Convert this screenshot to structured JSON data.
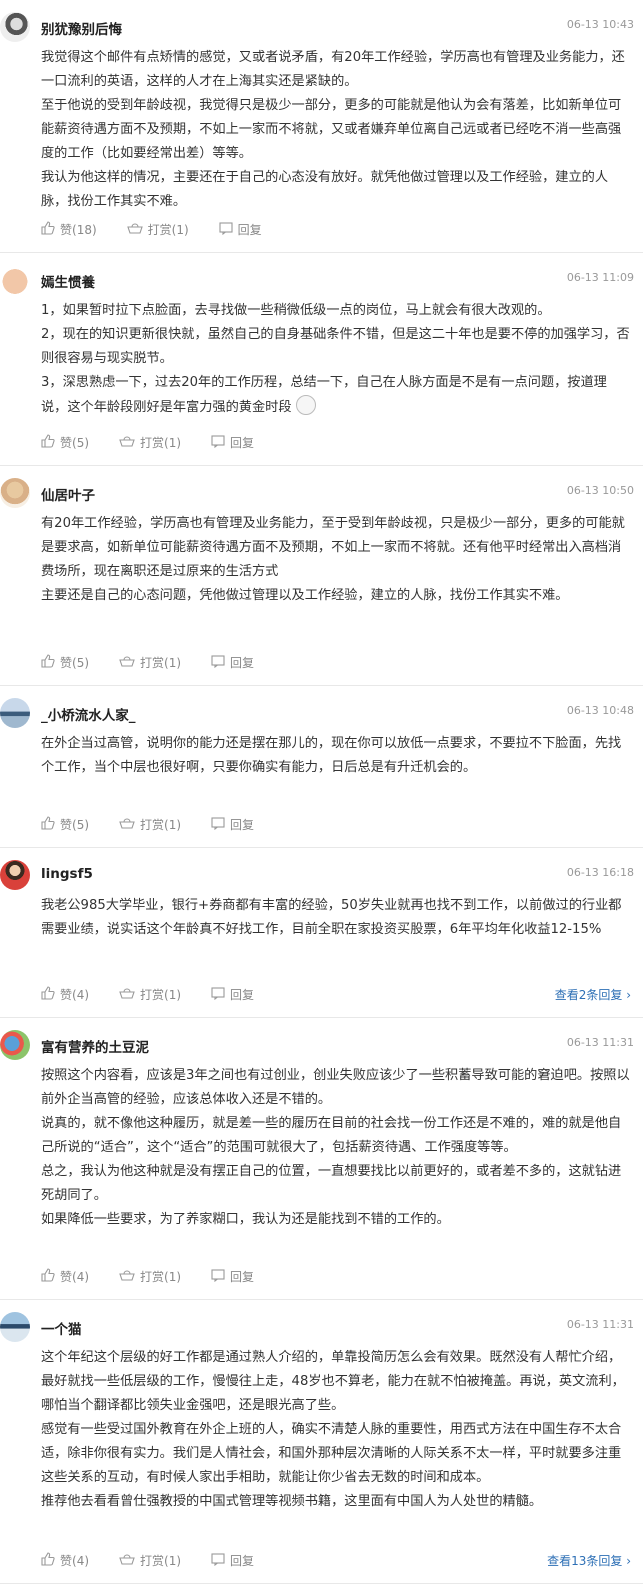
{
  "labels": {
    "like": "赞",
    "reward": "打赏",
    "reply": "回复"
  },
  "comments": [
    {
      "user": "别犹豫别后悔",
      "time": "06-13 10:43",
      "paragraphs": [
        "我觉得这个邮件有点矫情的感觉，又或者说矛盾，有20年工作经验，学历高也有管理及业务能力，还一口流利的英语，这样的人才在上海其实还是紧缺的。",
        "至于他说的受到年龄歧视，我觉得只是极少一部分，更多的可能就是他认为会有落差，比如新单位可能薪资待遇方面不及预期，不如上一家而不将就，又或者嫌弃单位离自己远或者已经吃不消一些高强度的工作（比如要经常出差）等等。",
        "我认为他这样的情况，主要还在于自己的心态没有放好。就凭他做过管理以及工作经验，建立的人脉，找份工作其实不难。"
      ],
      "likes": "(18)",
      "rewards": "(1)",
      "more_replies": ""
    },
    {
      "user": "嫣生惯養",
      "time": "06-13 11:09",
      "paragraphs": [
        "1，如果暂时拉下点脸面，去寻找做一些稍微低级一点的岗位，马上就会有很大改观的。",
        "2，现在的知识更新很快就，虽然自己的自身基础条件不错，但是这二十年也是要不停的加强学习，否则很容易与现实脱节。",
        "3，深思熟虑一下，过去20年的工作历程，总结一下，自己在人脉方面是不是有一点问题，按道理说，这个年龄段刚好是年富力强的黄金时段"
      ],
      "likes": "(5)",
      "rewards": "(1)",
      "more_replies": ""
    },
    {
      "user": "仙居叶子",
      "time": "06-13 10:50",
      "paragraphs": [
        "有20年工作经验，学历高也有管理及业务能力，至于受到年龄歧视，只是极少一部分，更多的可能就是要求高，如新单位可能薪资待遇方面不及预期，不如上一家而不将就。还有他平时经常出入高档消费场所，现在离职还是过原来的生活方式",
        "主要还是自己的心态问题，凭他做过管理以及工作经验，建立的人脉，找份工作其实不难。"
      ],
      "likes": "(5)",
      "rewards": "(1)",
      "more_replies": ""
    },
    {
      "user": "_小桥流水人家_",
      "time": "06-13 10:48",
      "paragraphs": [
        "在外企当过高管，说明你的能力还是摆在那儿的，现在你可以放低一点要求，不要拉不下脸面，先找个工作，当个中层也很好啊，只要你确实有能力，日后总是有升迁机会的。"
      ],
      "likes": "(5)",
      "rewards": "(1)",
      "more_replies": ""
    },
    {
      "user": "lingsf5",
      "time": "06-13 16:18",
      "paragraphs": [
        "我老公985大学毕业，银行+券商都有丰富的经验，50岁失业就再也找不到工作，以前做过的行业都需要业绩，说实话这个年龄真不好找工作，目前全职在家投资买股票，6年平均年化收益12-15%"
      ],
      "likes": "(4)",
      "rewards": "(1)",
      "more_replies": "查看2条回复 ›"
    },
    {
      "user": "富有营养的土豆泥",
      "time": "06-13 11:31",
      "paragraphs": [
        "按照这个内容看，应该是3年之间也有过创业，创业失败应该少了一些积蓄导致可能的窘迫吧。按照以前外企当高管的经验，应该总体收入还是不错的。",
        "说真的，就不像他这种履历，就是差一些的履历在目前的社会找一份工作还是不难的，难的就是他自己所说的“适合”，这个“适合”的范围可就很大了，包括薪资待遇、工作强度等等。",
        "总之，我认为他这种就是没有摆正自己的位置，一直想要找比以前更好的，或者差不多的，这就钻进死胡同了。",
        "如果降低一些要求，为了养家糊口，我认为还是能找到不错的工作的。"
      ],
      "likes": "(4)",
      "rewards": "(1)",
      "more_replies": ""
    },
    {
      "user": "一个猫",
      "time": "06-13 11:31",
      "paragraphs": [
        "这个年纪这个层级的好工作都是通过熟人介绍的，单靠投简历怎么会有效果。既然没有人帮忙介绍，最好就找一些低层级的工作，慢慢往上走，48岁也不算老，能力在就不怕被掩盖。再说，英文流利，哪怕当个翻译都比领失业金强吧，还是眼光高了些。",
        "感觉有一些受过国外教育在外企上班的人，确实不清楚人脉的重要性，用西式方法在中国生存不太合适，除非你很有实力。我们是人情社会，和国外那种层次清晰的人际关系不太一样，平时就要多注重这些关系的互动，有时候人家出手相助，就能让你少省去无数的时间和成本。",
        "推荐他去看看曾仕强教授的中国式管理等视频书籍，这里面有中国人为人处世的精髓。"
      ],
      "likes": "(4)",
      "rewards": "(1)",
      "more_replies": "查看13条回复 ›"
    }
  ]
}
